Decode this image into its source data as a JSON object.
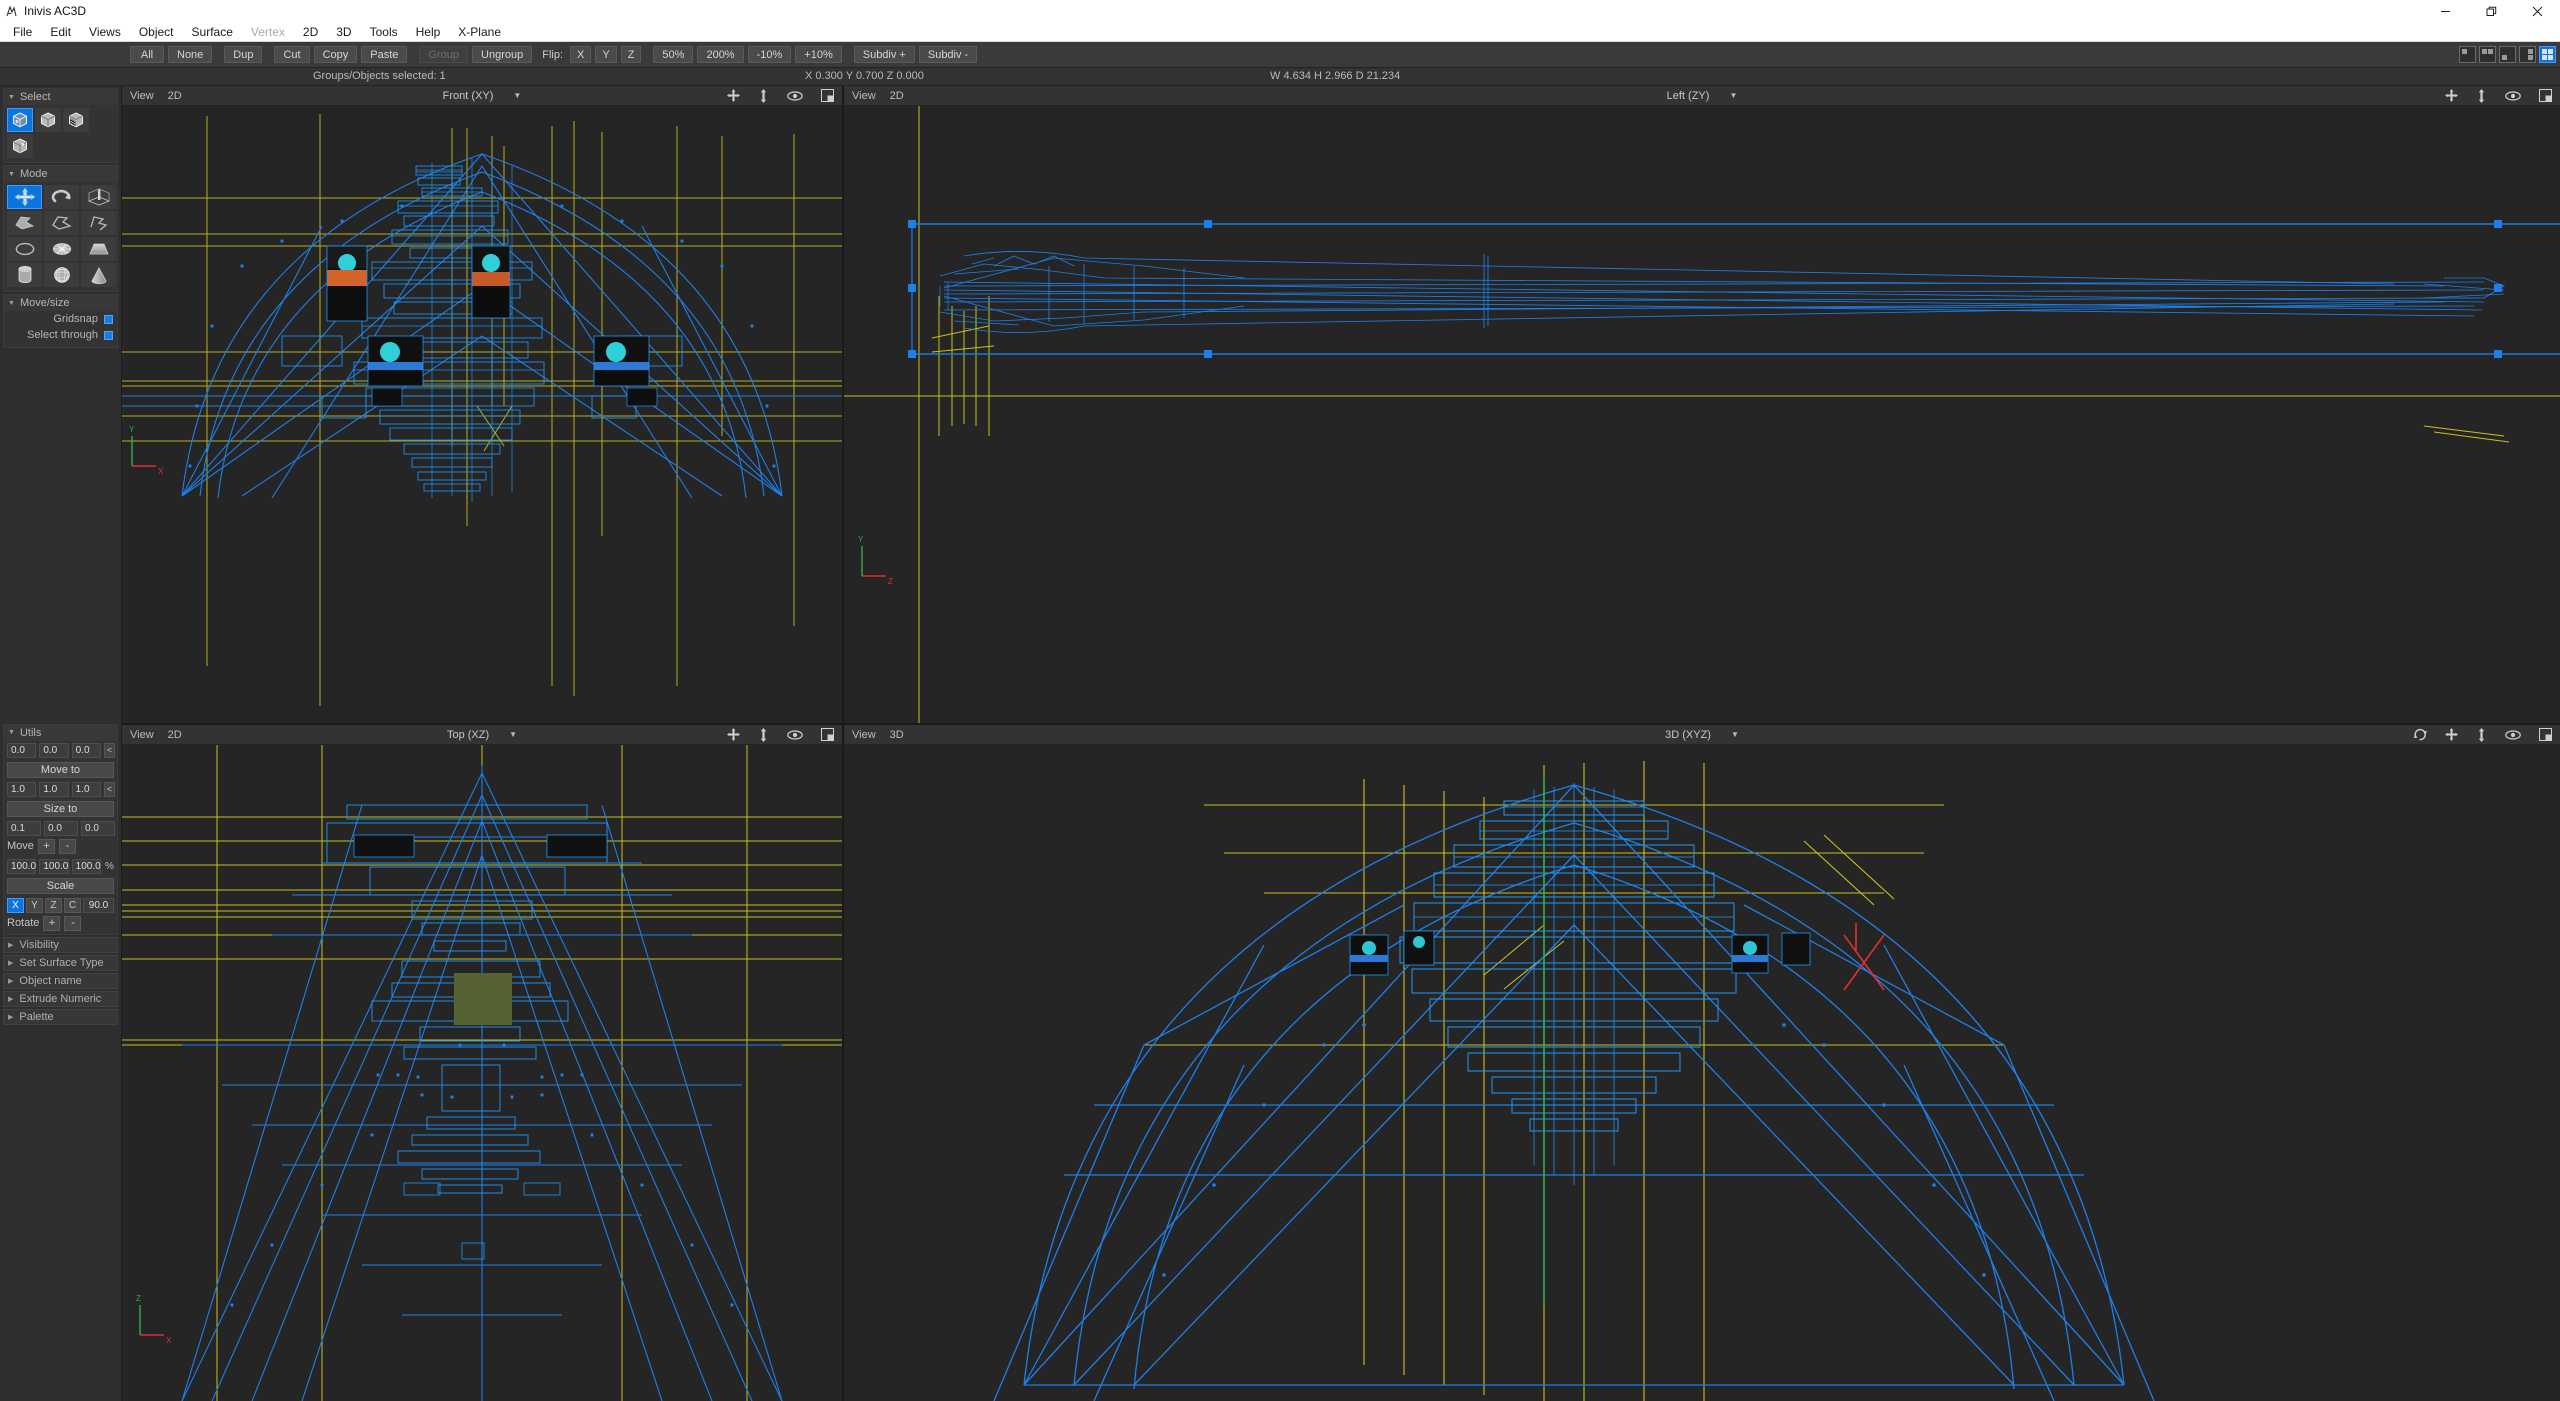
{
  "window": {
    "title": "Inivis AC3D",
    "app_icon": "ac3d-logo-icon",
    "controls": {
      "minimize": "minimize-icon",
      "maximize": "restore-icon",
      "close": "close-icon"
    }
  },
  "menubar": {
    "items": [
      {
        "label": "File",
        "disabled": false
      },
      {
        "label": "Edit",
        "disabled": false
      },
      {
        "label": "Views",
        "disabled": false
      },
      {
        "label": "Object",
        "disabled": false
      },
      {
        "label": "Surface",
        "disabled": false
      },
      {
        "label": "Vertex",
        "disabled": true
      },
      {
        "label": "2D",
        "disabled": false
      },
      {
        "label": "3D",
        "disabled": false
      },
      {
        "label": "Tools",
        "disabled": false
      },
      {
        "label": "Help",
        "disabled": false
      },
      {
        "label": "X-Plane",
        "disabled": false
      }
    ]
  },
  "toolbar": {
    "buttons": [
      {
        "label": "All",
        "disabled": false
      },
      {
        "label": "None",
        "disabled": false
      },
      {
        "label": "Dup",
        "disabled": false
      },
      {
        "label": "Cut",
        "disabled": false
      },
      {
        "label": "Copy",
        "disabled": false
      },
      {
        "label": "Paste",
        "disabled": false
      },
      {
        "label": "Group",
        "disabled": true
      },
      {
        "label": "Ungroup",
        "disabled": false
      }
    ],
    "flip_label": "Flip:",
    "flip_axes": [
      "X",
      "Y",
      "Z"
    ],
    "zoom_buttons": [
      "50%",
      "200%",
      "-10%",
      "+10%"
    ],
    "subdiv_buttons": [
      "Subdiv +",
      "Subdiv -"
    ],
    "layout_buttons": [
      {
        "name": "layout-single",
        "active": false
      },
      {
        "name": "layout-two-pane",
        "active": false
      },
      {
        "name": "layout-three-pane",
        "active": false
      },
      {
        "name": "layout-wide-split",
        "active": false
      },
      {
        "name": "layout-quad",
        "active": true
      }
    ]
  },
  "status": {
    "selection": "Groups/Objects selected: 1",
    "coords": "X 0.300 Y 0.700 Z 0.000",
    "dimensions": "W 4.634 H 2.966 D 21.234"
  },
  "sidebar": {
    "select_panel": {
      "title": "Select",
      "items": [
        {
          "name": "select-group-icon",
          "selected": true
        },
        {
          "name": "select-object-icon",
          "selected": false
        },
        {
          "name": "select-surface-icon",
          "selected": false
        },
        {
          "name": "select-vertex-icon",
          "selected": false
        }
      ]
    },
    "mode_panel": {
      "title": "Mode",
      "items": [
        {
          "name": "move-tool-icon",
          "selected": true
        },
        {
          "name": "rotate-tool-icon",
          "selected": false
        },
        {
          "name": "scale-tool-icon",
          "selected": false
        },
        {
          "name": "polygon-fill-icon",
          "selected": false
        },
        {
          "name": "polygon-outline-icon",
          "selected": false
        },
        {
          "name": "polyline-icon",
          "selected": false
        },
        {
          "name": "circle-icon",
          "selected": false
        },
        {
          "name": "disc-icon",
          "selected": false
        },
        {
          "name": "slab-icon",
          "selected": false
        },
        {
          "name": "cylinder-icon",
          "selected": false
        },
        {
          "name": "sphere-icon",
          "selected": false
        },
        {
          "name": "cone-icon",
          "selected": false
        }
      ]
    },
    "movesize_panel": {
      "title": "Move/size",
      "rows": [
        {
          "label": "Gridsnap",
          "checked": true
        },
        {
          "label": "Select through",
          "checked": true
        }
      ]
    },
    "utils_panel": {
      "title": "Utils",
      "move_to": {
        "values": [
          "0.0",
          "0.0",
          "0.0"
        ],
        "chevron": "<",
        "button": "Move to"
      },
      "size_to": {
        "values": [
          "1.0",
          "1.0",
          "1.0"
        ],
        "chevron": "<",
        "button": "Size to"
      },
      "move_step": {
        "values": [
          "0.1",
          "0.0",
          "0.0"
        ],
        "label": "Move",
        "plus": "+",
        "minus": "-"
      },
      "scale": {
        "values": [
          "100.0",
          "100.0",
          "100.0"
        ],
        "unit": "%",
        "button": "Scale"
      },
      "rotate": {
        "axes": [
          {
            "label": "X",
            "active": true
          },
          {
            "label": "Y",
            "active": false
          },
          {
            "label": "Z",
            "active": false
          },
          {
            "label": "C",
            "active": false
          }
        ],
        "angle": "90.0",
        "label": "Rotate",
        "plus": "+",
        "minus": "-"
      }
    },
    "collapsed_panels": [
      {
        "label": "Visibility"
      },
      {
        "label": "Set Surface Type"
      },
      {
        "label": "Object name"
      },
      {
        "label": "Extrude Numeric"
      },
      {
        "label": "Palette"
      }
    ]
  },
  "viewports": [
    {
      "id": "front",
      "view_label": "View",
      "mode_label": "2D",
      "projection": "Front (XY)",
      "dropdown_arrow": "chevron-down-icon",
      "active": false,
      "tools": [
        "pan-icon",
        "zoom-icon",
        "eye-icon",
        "maximize-icon"
      ],
      "gizmo": {
        "y": "Y",
        "x": "X"
      }
    },
    {
      "id": "left",
      "view_label": "View",
      "mode_label": "2D",
      "projection": "Left (ZY)",
      "dropdown_arrow": "chevron-down-icon",
      "active": false,
      "tools": [
        "pan-icon",
        "zoom-icon",
        "eye-icon",
        "maximize-icon"
      ],
      "gizmo": {
        "y": "Y",
        "x": "Z"
      }
    },
    {
      "id": "top",
      "view_label": "View",
      "mode_label": "2D",
      "projection": "Top (XZ)",
      "dropdown_arrow": "chevron-down-icon",
      "active": false,
      "tools": [
        "pan-icon",
        "zoom-icon",
        "eye-icon",
        "maximize-icon"
      ],
      "gizmo": {
        "y": "Z",
        "x": "X"
      }
    },
    {
      "id": "persp",
      "view_label": "View",
      "mode_label": "3D",
      "projection": "3D (XYZ)",
      "dropdown_arrow": "chevron-down-icon",
      "active": true,
      "tools": [
        "orbit-icon",
        "pan-icon",
        "zoom-icon",
        "eye-icon",
        "maximize-icon"
      ],
      "gizmo": null
    }
  ],
  "colors": {
    "wireframe_blue": "#1e7fe8",
    "guide_yellow": "#d8cf28",
    "selection_blue": "#0a75e0",
    "panel_bg": "#333333",
    "viewport_bg": "#252525",
    "axis_green": "#2fae4a",
    "axis_red": "#e03030"
  }
}
